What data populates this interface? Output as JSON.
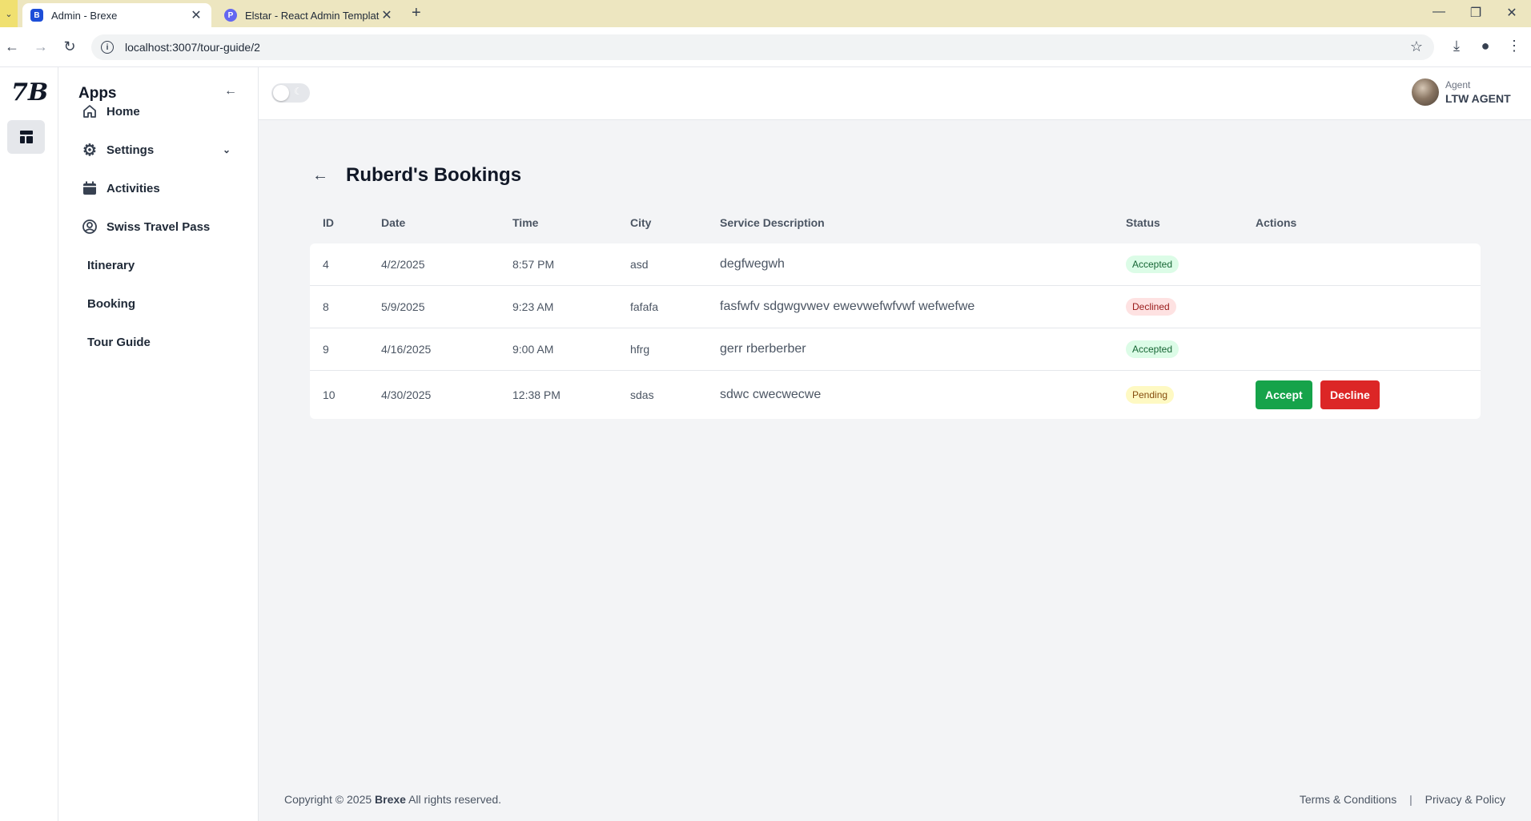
{
  "browser": {
    "tabs": [
      {
        "title": "Admin - Brexe",
        "active": true
      },
      {
        "title": "Elstar - React Admin Template",
        "active": false
      }
    ],
    "url": "localhost:3007/tour-guide/2"
  },
  "sidebar": {
    "heading": "Apps",
    "items": [
      {
        "label": "Home",
        "icon": "home-icon"
      },
      {
        "label": "Settings",
        "icon": "gear-icon"
      },
      {
        "label": "Activities",
        "icon": "calendar-icon"
      },
      {
        "label": "Swiss Travel Pass",
        "icon": "user-circle-icon"
      },
      {
        "label": "Itinerary"
      },
      {
        "label": "Booking"
      },
      {
        "label": "Tour Guide"
      }
    ]
  },
  "header": {
    "user_role": "Agent",
    "user_name": "LTW AGENT"
  },
  "page": {
    "title": "Ruberd's Bookings"
  },
  "table": {
    "columns": [
      "ID",
      "Date",
      "Time",
      "City",
      "Service Description",
      "Status",
      "Actions"
    ],
    "rows": [
      {
        "id": "4",
        "date": "4/2/2025",
        "time": "8:57 PM",
        "city": "asd",
        "desc": "degfwegwh",
        "status": "Accepted"
      },
      {
        "id": "8",
        "date": "5/9/2025",
        "time": "9:23 AM",
        "city": "fafafa",
        "desc": "fasfwfv sdgwgvwev ewevwefwfvwf wefwefwe",
        "status": "Declined"
      },
      {
        "id": "9",
        "date": "4/16/2025",
        "time": "9:00 AM",
        "city": "hfrg",
        "desc": "gerr rberberber",
        "status": "Accepted"
      },
      {
        "id": "10",
        "date": "4/30/2025",
        "time": "12:38 PM",
        "city": "sdas",
        "desc": "sdwc cwecwecwe",
        "status": "Pending"
      }
    ],
    "accept_label": "Accept",
    "decline_label": "Decline"
  },
  "footer": {
    "copyright_prefix": "Copyright © 2025",
    "brand": "Brexe",
    "copyright_suffix": "All rights reserved.",
    "terms": "Terms & Conditions",
    "separator": "|",
    "privacy": "Privacy & Policy"
  },
  "colors": {
    "accept": "#16a34a",
    "decline": "#dc2626"
  }
}
